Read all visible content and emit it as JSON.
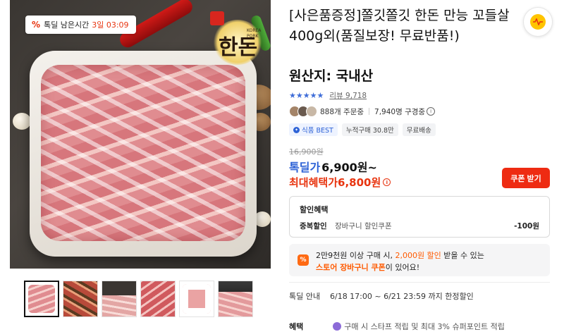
{
  "gallery": {
    "timer": {
      "label": "톡딜 남은시간",
      "remaining": "3일 03:09"
    },
    "logo": {
      "stamp": "우리돼지",
      "title": "한돈",
      "sub": "KOREA PORK"
    },
    "thumbnails": [
      "thumb-1",
      "thumb-2",
      "thumb-3",
      "thumb-4",
      "thumb-5",
      "thumb-6"
    ]
  },
  "product": {
    "title": "[사은품증정]쫄깃쫄깃 한돈 만능 꼬들살 400g외(품질보장! 무료반품!)",
    "origin": "원산지: 국내산"
  },
  "rating": {
    "stars": 4.5,
    "review_label": "리뷰",
    "review_count": "9,718"
  },
  "orders": {
    "ordering": "888개 주문중",
    "subscribers": "7,940명 구경중"
  },
  "tags": [
    {
      "label": "식품 BEST",
      "icon": "badge-icon"
    },
    {
      "label": "누적구매 30.8만"
    },
    {
      "label": "무료배송"
    }
  ],
  "price": {
    "original": "16,900원",
    "deal_label": "톡딜가",
    "deal_value": "6,900원~",
    "max_label": "최대혜택가",
    "max_value": "6,800원"
  },
  "coupon_button": "쿠폰 받기",
  "discount": {
    "title": "할인혜택",
    "item_label": "중복할인",
    "item_desc": "장바구니 할인쿠폰",
    "item_amount": "-100원"
  },
  "promo": {
    "line1_prefix": "2만9천원 이상 구매 시, ",
    "line1_highlight": "2,000원 할인",
    "line1_suffix": " 받을 수 있는",
    "line2_highlight": "스토어 장바구니 쿠폰",
    "line2_suffix": "이 있어요!"
  },
  "notice": {
    "label": "톡딜 안내",
    "value": "6/18 17:00 ~ 6/21 23:59 까지 한정할인"
  },
  "benefit": {
    "label": "혜택",
    "value": "구매 시 스타프 적립 및 최대 3% 슈퍼포인트 적립"
  },
  "colors": {
    "accent_blue": "#2d62d6",
    "accent_red": "#e8340f",
    "coupon_red": "#ee2b12",
    "promo_orange": "#ff5a00"
  }
}
